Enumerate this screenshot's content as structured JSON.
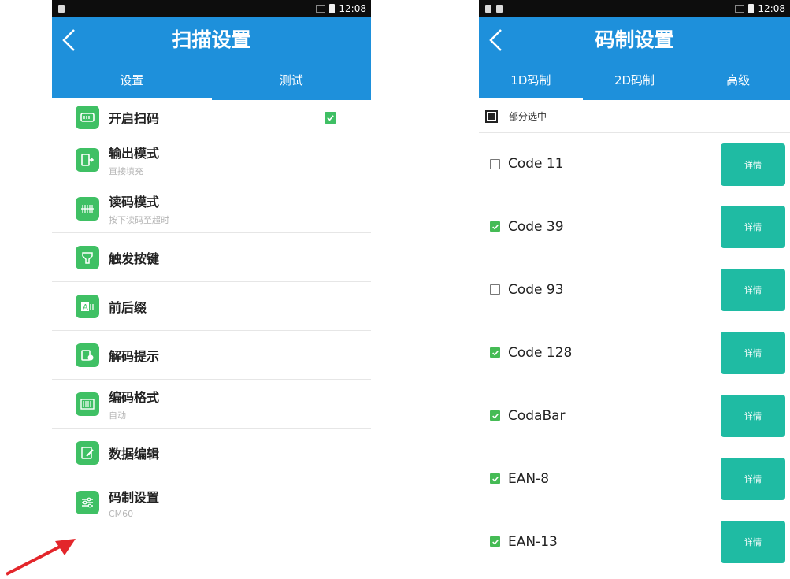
{
  "left": {
    "status_time": "12:08",
    "title": "扫描设置",
    "tabs": [
      {
        "label": "设置",
        "active": true
      },
      {
        "label": "测试",
        "active": false
      }
    ],
    "items": [
      {
        "label": "开启扫码",
        "sub": "",
        "icon": "scanner-icon",
        "checked": true
      },
      {
        "label": "输出模式",
        "sub": "直接填充",
        "icon": "output-icon"
      },
      {
        "label": "读码模式",
        "sub": "按下读码至超时",
        "icon": "barcode-read-icon"
      },
      {
        "label": "触发按键",
        "sub": "",
        "icon": "trigger-key-icon"
      },
      {
        "label": "前后缀",
        "sub": "",
        "icon": "prefix-suffix-icon"
      },
      {
        "label": "解码提示",
        "sub": "",
        "icon": "decode-hint-icon"
      },
      {
        "label": "编码格式",
        "sub": "自动",
        "icon": "encoding-icon"
      },
      {
        "label": "数据编辑",
        "sub": "",
        "icon": "edit-icon"
      },
      {
        "label": "码制设置",
        "sub": "CM60",
        "icon": "sliders-icon"
      }
    ]
  },
  "right": {
    "status_time": "12:08",
    "title": "码制设置",
    "tabs": [
      {
        "label": "1D码制",
        "active": true
      },
      {
        "label": "2D码制",
        "active": false
      },
      {
        "label": "高级",
        "active": false
      }
    ],
    "partial_label": "部分选中",
    "codes": [
      {
        "name": "Code 11",
        "checked": false,
        "detail": "详情"
      },
      {
        "name": "Code 39",
        "checked": true,
        "detail": "详情"
      },
      {
        "name": "Code 93",
        "checked": false,
        "detail": "详情"
      },
      {
        "name": "Code 128",
        "checked": true,
        "detail": "详情"
      },
      {
        "name": "CodaBar",
        "checked": true,
        "detail": "详情"
      },
      {
        "name": "EAN-8",
        "checked": true,
        "detail": "详情"
      },
      {
        "name": "EAN-13",
        "checked": true,
        "detail": "详情"
      }
    ]
  },
  "colors": {
    "appbar": "#1e90db",
    "icon_green": "#3fc064",
    "detail_button": "#1fbba3",
    "arrow": "#e3262b"
  }
}
